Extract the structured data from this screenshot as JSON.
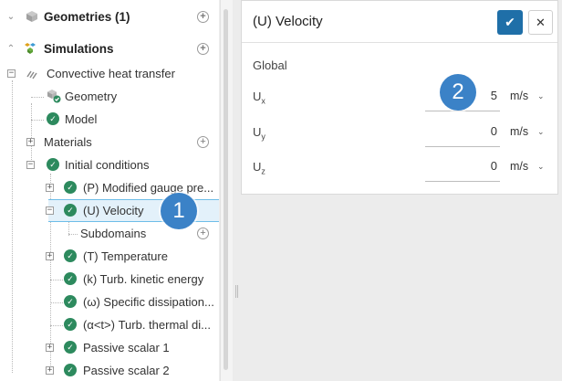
{
  "tree": {
    "geometries": {
      "label": "Geometries (1)",
      "add": "+"
    },
    "simulations": {
      "label": "Simulations",
      "add": "+"
    },
    "simulation_name": "Convective heat transfer",
    "geometry": "Geometry",
    "model": "Model",
    "materials": {
      "label": "Materials",
      "add": "+"
    },
    "initial_conditions": "Initial conditions",
    "ic_items": [
      {
        "label": "(P) Modified gauge pre..."
      },
      {
        "label": "(U) Velocity"
      },
      {
        "label": "Subdomains",
        "add": "+"
      },
      {
        "label": "(T) Temperature"
      },
      {
        "label": "(k) Turb. kinetic energy"
      },
      {
        "label": "(ω) Specific dissipation..."
      },
      {
        "label": "(α<t>) Turb. thermal di..."
      },
      {
        "label": "Passive scalar 1"
      },
      {
        "label": "Passive scalar 2"
      }
    ]
  },
  "dialog": {
    "title": "(U) Velocity",
    "ok_icon": "✔",
    "close_icon": "✕",
    "group": "Global",
    "fields": [
      {
        "label": "U",
        "sub": "x",
        "value": "5",
        "unit": "m/s"
      },
      {
        "label": "U",
        "sub": "y",
        "value": "0",
        "unit": "m/s"
      },
      {
        "label": "U",
        "sub": "z",
        "value": "0",
        "unit": "m/s"
      }
    ]
  },
  "callouts": {
    "first": "1",
    "second": "2"
  },
  "colors": {
    "accent": "#1f6fa8",
    "check": "#2d8a5e",
    "badge": "#3b82c7",
    "selected_bg": "#e3f1fa"
  }
}
